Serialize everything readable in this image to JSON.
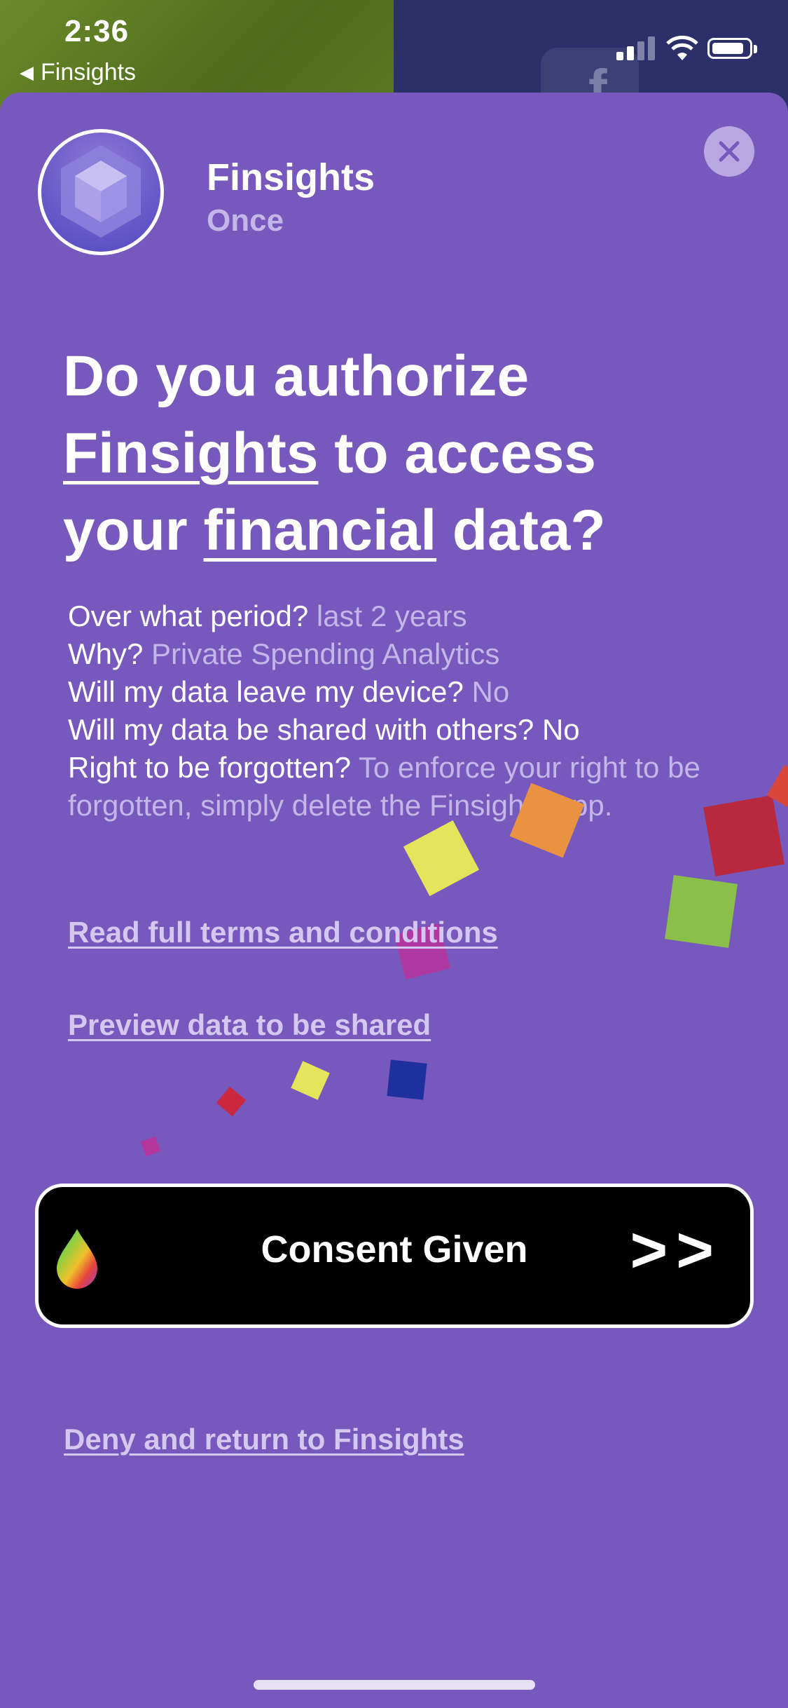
{
  "status_bar": {
    "time": "2:36",
    "back_label": "Finsights"
  },
  "background_app": {
    "icon_letter": "f"
  },
  "app": {
    "name": "Finsights",
    "frequency": "Once"
  },
  "headline": {
    "part1": "Do you authorize",
    "app_link": "Finsights",
    "part2": " to access",
    "part3": "your ",
    "data_link": "financial",
    "part4": " data?"
  },
  "details": [
    {
      "question": "Over what period?",
      "answer": " last 2 years"
    },
    {
      "question": "Why?",
      "answer": " Private Spending Analytics"
    },
    {
      "question": "Will my data leave my device?",
      "answer": " No"
    },
    {
      "question": "Will my data be shared with others? No",
      "answer": ""
    },
    {
      "question": "Right to be forgotten?",
      "answer": " To enforce your right to be forgotten, simply delete the Finsights app."
    }
  ],
  "links": {
    "terms": "Read full terms and conditions",
    "preview": "Preview data to be shared",
    "deny": "Deny and return to Finsights"
  },
  "consent_button": {
    "label": "Consent Given",
    "arrows": ">>"
  },
  "colors": {
    "sheet": "#7758bc",
    "muted_text": "#c3b6e8",
    "button": "#000000"
  }
}
